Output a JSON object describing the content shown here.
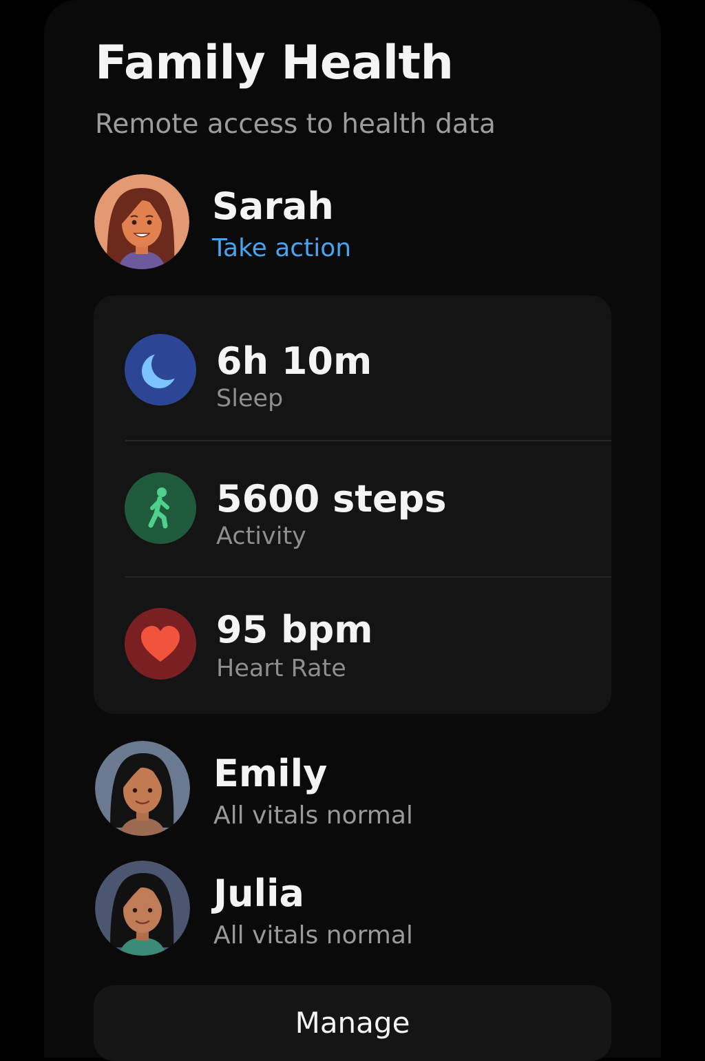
{
  "header": {
    "title": "Family Health",
    "subtitle": "Remote access to health data"
  },
  "primary_member": {
    "name": "Sarah",
    "action_label": "Take action",
    "avatar_icon": "avatar-woman-brown-hair",
    "metrics": [
      {
        "value": "6h 10m",
        "label": "Sleep",
        "icon": "moon-icon",
        "color": "#2c4595"
      },
      {
        "value": "5600 steps",
        "label": "Activity",
        "icon": "walking-person-icon",
        "color": "#1f5a3d"
      },
      {
        "value": "95 bpm",
        "label": "Heart Rate",
        "icon": "heart-icon",
        "color": "#7a1f22"
      }
    ]
  },
  "members": [
    {
      "name": "Emily",
      "status": "All vitals normal",
      "avatar_icon": "avatar-woman-black-hair"
    },
    {
      "name": "Julia",
      "status": "All vitals normal",
      "avatar_icon": "avatar-woman-black-hair"
    }
  ],
  "footer": {
    "manage_label": "Manage"
  },
  "colors": {
    "accent_link": "#4aa3f0",
    "background": "#000000",
    "card": "#141414"
  }
}
